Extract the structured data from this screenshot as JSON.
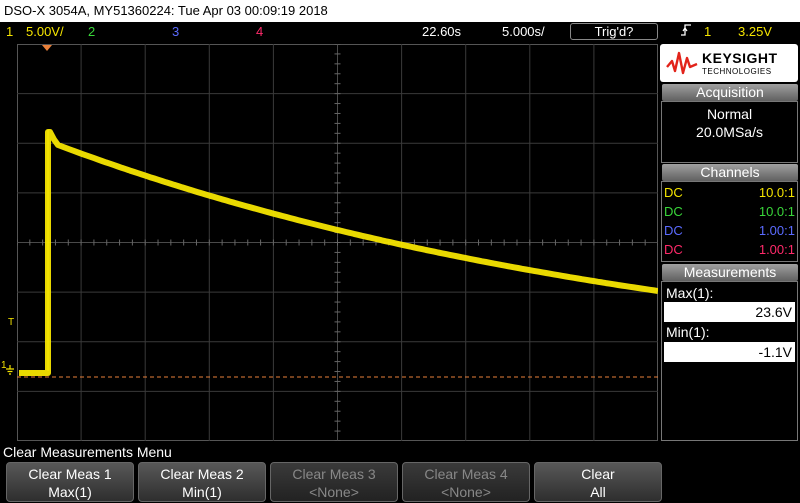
{
  "title": "DSO-X 3054A, MY51360224: Tue Apr 03 00:09:19 2018",
  "status": {
    "ch1_num": "1",
    "ch1_scale": "5.00V/",
    "ch2_num": "2",
    "ch3_num": "3",
    "ch4_num": "4",
    "time_delay": "22.60s",
    "time_scale": "5.000s/",
    "trig_state": "Trig'd?",
    "trig_slope_icon": "rising-edge-icon",
    "trig_source": "1",
    "trig_level": "3.25V"
  },
  "colors": {
    "ch1": "#f5e500",
    "ch2": "#39d63a",
    "ch3": "#5b6bff",
    "ch4": "#ff2a6a",
    "ground_ref": "#e8803a"
  },
  "logo": {
    "brand": "KEYSIGHT",
    "sub": "TECHNOLOGIES"
  },
  "acquisition": {
    "header": "Acquisition",
    "mode": "Normal",
    "rate": "20.0MSa/s"
  },
  "channels": {
    "header": "Channels",
    "rows": [
      {
        "coupling": "DC",
        "probe": "10.0:1"
      },
      {
        "coupling": "DC",
        "probe": "10.0:1"
      },
      {
        "coupling": "DC",
        "probe": "1.00:1"
      },
      {
        "coupling": "DC",
        "probe": "1.00:1"
      }
    ]
  },
  "measurements": {
    "header": "Measurements",
    "items": [
      {
        "label": "Max(1):",
        "value": "23.6V"
      },
      {
        "label": "Min(1):",
        "value": "-1.1V"
      }
    ]
  },
  "markers": {
    "trigger_level": "T",
    "ch1_ground": "1"
  },
  "menu": {
    "title": "Clear Measurements Menu",
    "softkeys": [
      {
        "line1": "Clear Meas 1",
        "line2": "Max(1)",
        "enabled": true
      },
      {
        "line1": "Clear Meas 2",
        "line2": "Min(1)",
        "enabled": true
      },
      {
        "line1": "Clear Meas 3",
        "line2": "<None>",
        "enabled": false
      },
      {
        "line1": "Clear Meas 4",
        "line2": "<None>",
        "enabled": false
      },
      {
        "line1": "Clear",
        "line2": "All",
        "enabled": true
      }
    ]
  }
}
